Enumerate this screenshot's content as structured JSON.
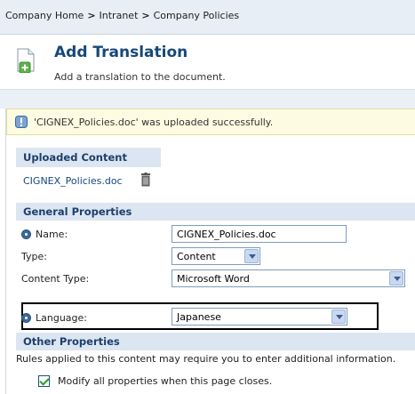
{
  "breadcrumb": {
    "items": [
      "Company Home",
      "Intranet",
      "Company Policies"
    ],
    "separator": ">"
  },
  "header": {
    "title": "Add Translation",
    "subtitle": "Add a translation to the document.",
    "icon": "add-document-icon"
  },
  "notice": {
    "icon": "info-icon",
    "text": "'CIGNEX_Policies.doc' was uploaded successfully."
  },
  "uploaded": {
    "heading": "Uploaded Content",
    "file_name": "CIGNEX_Policies.doc",
    "delete_icon": "trash-icon"
  },
  "general": {
    "heading": "General Properties",
    "name_label": "Name:",
    "name_value": "CIGNEX_Policies.doc",
    "type_label": "Type:",
    "type_value": "Content",
    "content_type_label": "Content Type:",
    "content_type_value": "Microsoft Word",
    "language_label": "Language:",
    "language_value": "Japanese"
  },
  "other": {
    "heading": "Other Properties",
    "rules_text": "Rules applied to this content may require you to enter additional information.",
    "checkbox_label": "Modify all properties when this page closes.",
    "checkbox_checked": true
  },
  "colors": {
    "accent": "#16487a",
    "section_bg": "#dce6f2",
    "notice_bg": "#fdfbe2"
  }
}
